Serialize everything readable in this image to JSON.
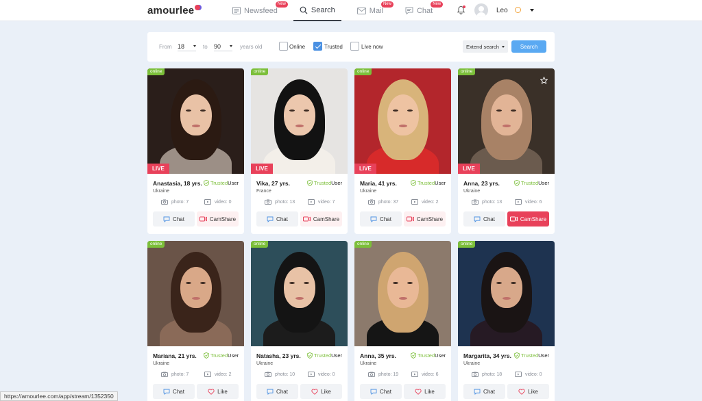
{
  "header": {
    "logo": "amourlee",
    "nav": [
      {
        "label": "Newsfeed",
        "badge": "New",
        "icon": "newsfeed-icon"
      },
      {
        "label": "Search",
        "badge": "",
        "icon": "search-icon"
      },
      {
        "label": "Mail",
        "badge": "New",
        "icon": "mail-icon"
      },
      {
        "label": "Chat",
        "badge": "New",
        "icon": "chat-icon"
      }
    ],
    "user_name": "Leo"
  },
  "filter": {
    "from_label": "From",
    "from_value": "18",
    "to_label": "to",
    "to_value": "90",
    "years_label": "years old",
    "online_label": "Online",
    "online_checked": false,
    "trusted_label": "Trusted",
    "trusted_checked": true,
    "live_label": "Live now",
    "live_checked": false,
    "extend_label": "Extend search",
    "search_label": "Search"
  },
  "colors": {
    "accent": "#5aa9f2",
    "live": "#e8415a",
    "online": "#7cbf3a"
  },
  "cards": [
    {
      "name": "Anastasia, 18 yrs.",
      "country": "Ukraine",
      "online": "online",
      "live": "LIVE",
      "trusted": "Trusted",
      "trusted_suffix": "User",
      "photo": "photo: 7",
      "video": "video: 0",
      "btn1": "Chat",
      "btn2": "CamShare",
      "btn2_type": "cam"
    },
    {
      "name": "Vika, 27 yrs.",
      "country": "France",
      "online": "online",
      "live": "LIVE",
      "trusted": "Trusted",
      "trusted_suffix": "User",
      "photo": "photo: 13",
      "video": "video: 7",
      "btn1": "Chat",
      "btn2": "CamShare",
      "btn2_type": "cam"
    },
    {
      "name": "Maria, 41 yrs.",
      "country": "Ukraine",
      "online": "online",
      "live": "LIVE",
      "trusted": "Trusted",
      "trusted_suffix": "User",
      "photo": "photo: 37",
      "video": "video: 2",
      "btn1": "Chat",
      "btn2": "CamShare",
      "btn2_type": "cam"
    },
    {
      "name": "Anna, 23 yrs.",
      "country": "Ukraine",
      "online": "online",
      "live": "LIVE",
      "trusted": "Trusted",
      "trusted_suffix": "User",
      "photo": "photo: 13",
      "video": "video: 6",
      "btn1": "Chat",
      "btn2": "CamShare",
      "btn2_type": "cam-active"
    },
    {
      "name": "Mariana, 21 yrs.",
      "country": "Ukraine",
      "online": "online",
      "live": "",
      "trusted": "Trusted",
      "trusted_suffix": "User",
      "photo": "photo: 7",
      "video": "video: 2",
      "btn1": "Chat",
      "btn2": "Like",
      "btn2_type": "like"
    },
    {
      "name": "Natasha, 23 yrs.",
      "country": "Ukraine",
      "online": "online",
      "live": "",
      "trusted": "Trusted",
      "trusted_suffix": "User",
      "photo": "photo: 10",
      "video": "video: 0",
      "btn1": "Chat",
      "btn2": "Like",
      "btn2_type": "like"
    },
    {
      "name": "Anna, 35 yrs.",
      "country": "Ukraine",
      "online": "online",
      "live": "",
      "trusted": "Trusted",
      "trusted_suffix": "User",
      "photo": "photo: 19",
      "video": "video: 6",
      "btn1": "Chat",
      "btn2": "Like",
      "btn2_type": "like"
    },
    {
      "name": "Margarita, 34 yrs.",
      "country": "Ukraine",
      "online": "online",
      "live": "",
      "trusted": "Trusted",
      "trusted_suffix": "User",
      "photo": "photo: 18",
      "video": "video: 0",
      "btn1": "Chat",
      "btn2": "Like",
      "btn2_type": "like"
    }
  ],
  "status_url": "https://amourlee.com/app/stream/1352350"
}
